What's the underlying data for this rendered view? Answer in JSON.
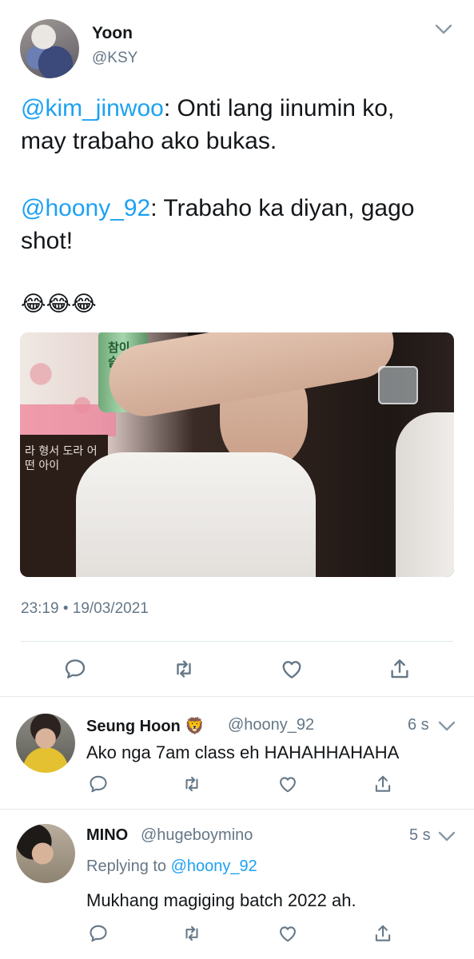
{
  "tweet": {
    "author_name": "Yoon",
    "author_handle": "@KSY",
    "line1_mention": "@kim_jinwoo",
    "line1_text": ": Onti lang iinumin ko,",
    "line2_text": "may trabaho ako bukas.",
    "line3_mention": "@hoony_92",
    "line3_text": ": Trabaho ka diyan, gago",
    "line4_text": "shot!",
    "emojis": [
      "😂",
      "😂",
      "😂"
    ],
    "timestamp": "23:19 • 19/03/2021",
    "media_text_bottle": "참이슬",
    "media_text_wall": "라 형서 도라 어떤 아이"
  },
  "actions": {
    "reply_icon": "comment-icon",
    "retweet_icon": "retweet-icon",
    "like_icon": "heart-icon",
    "share_icon": "share-icon"
  },
  "replies": [
    {
      "name": "Seung Hoon",
      "badge_emoji": "🦁",
      "handle": "@hoony_92",
      "time": "6 s",
      "text": "Ako nga 7am class eh HAHAHHAHAHA"
    },
    {
      "name": "MINO",
      "handle": "@hugeboymino",
      "time": "5 s",
      "replying_prefix": "Replying to ",
      "replying_to": "@hoony_92",
      "text": "Mukhang magiging batch 2022 ah."
    }
  ],
  "colors": {
    "accent": "#1da1f2",
    "muted": "#657786",
    "text": "#14171a",
    "divider": "#e1e8ed"
  }
}
